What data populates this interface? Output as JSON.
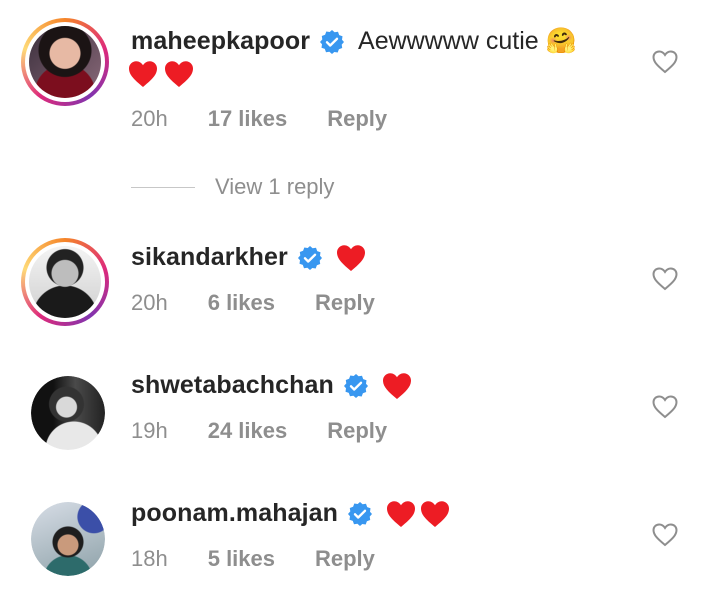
{
  "comments": [
    {
      "username": "maheepkapoor",
      "verified": true,
      "text": "Aewwwww cutie 🤗",
      "hearts": 2,
      "time": "20h",
      "likes": "17 likes",
      "reply_label": "Reply",
      "story_ring": true
    },
    {
      "username": "sikandarkher",
      "verified": true,
      "text": "",
      "hearts": 1,
      "time": "20h",
      "likes": "6 likes",
      "reply_label": "Reply",
      "story_ring": true
    },
    {
      "username": "shwetabachchan",
      "verified": true,
      "text": "",
      "hearts": 1,
      "time": "19h",
      "likes": "24 likes",
      "reply_label": "Reply",
      "story_ring": false
    },
    {
      "username": "poonam.mahajan",
      "verified": true,
      "text": "",
      "hearts": 2,
      "time": "18h",
      "likes": "5 likes",
      "reply_label": "Reply",
      "story_ring": false
    }
  ],
  "view_replies": "View 1 reply",
  "colors": {
    "heart": "#ed1c24",
    "verified": "#3897f0",
    "meta": "#8e8e8e"
  }
}
